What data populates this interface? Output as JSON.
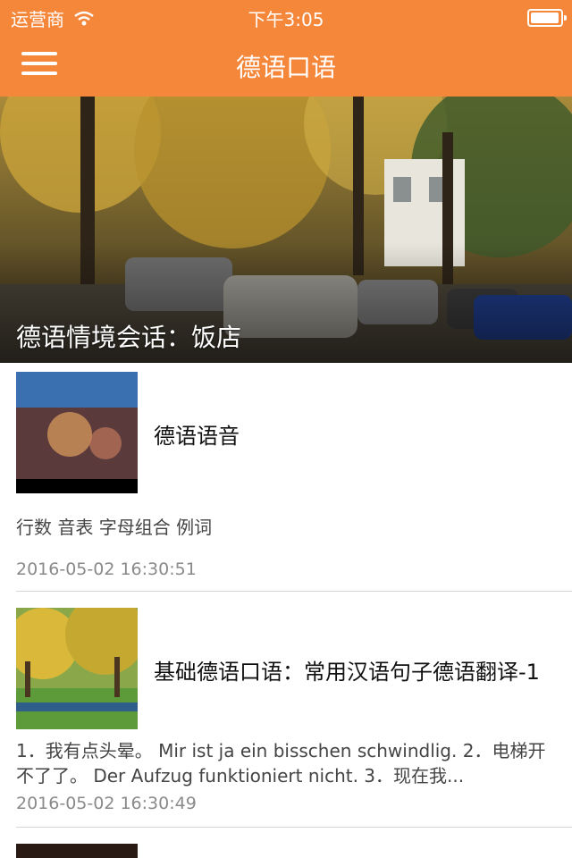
{
  "status_bar": {
    "carrier": "运营商",
    "time": "下午3:05",
    "wifi_icon": "wifi-icon",
    "battery_icon": "battery-icon"
  },
  "nav": {
    "title": "德语口语",
    "menu_icon": "hamburger-menu-icon"
  },
  "hero": {
    "caption": "德语情境会话：饭店"
  },
  "articles": [
    {
      "title": "德语语音",
      "description": "行数 音表 字母组合 例词",
      "time": "2016-05-02 16:30:51"
    },
    {
      "title": "基础德语口语：常用汉语句子德语翻译-1",
      "description": "1．我有点头晕。 Mir ist ja ein bisschen schwindlig. 2．电梯开不了了。 Der Aufzug funktioniert nicht. 3．现在我...",
      "time": "2016-05-02 16:30:49"
    }
  ],
  "colors": {
    "accent": "#f5873b",
    "divider": "#d6d6d6",
    "timestamp": "#8a8a8a"
  }
}
